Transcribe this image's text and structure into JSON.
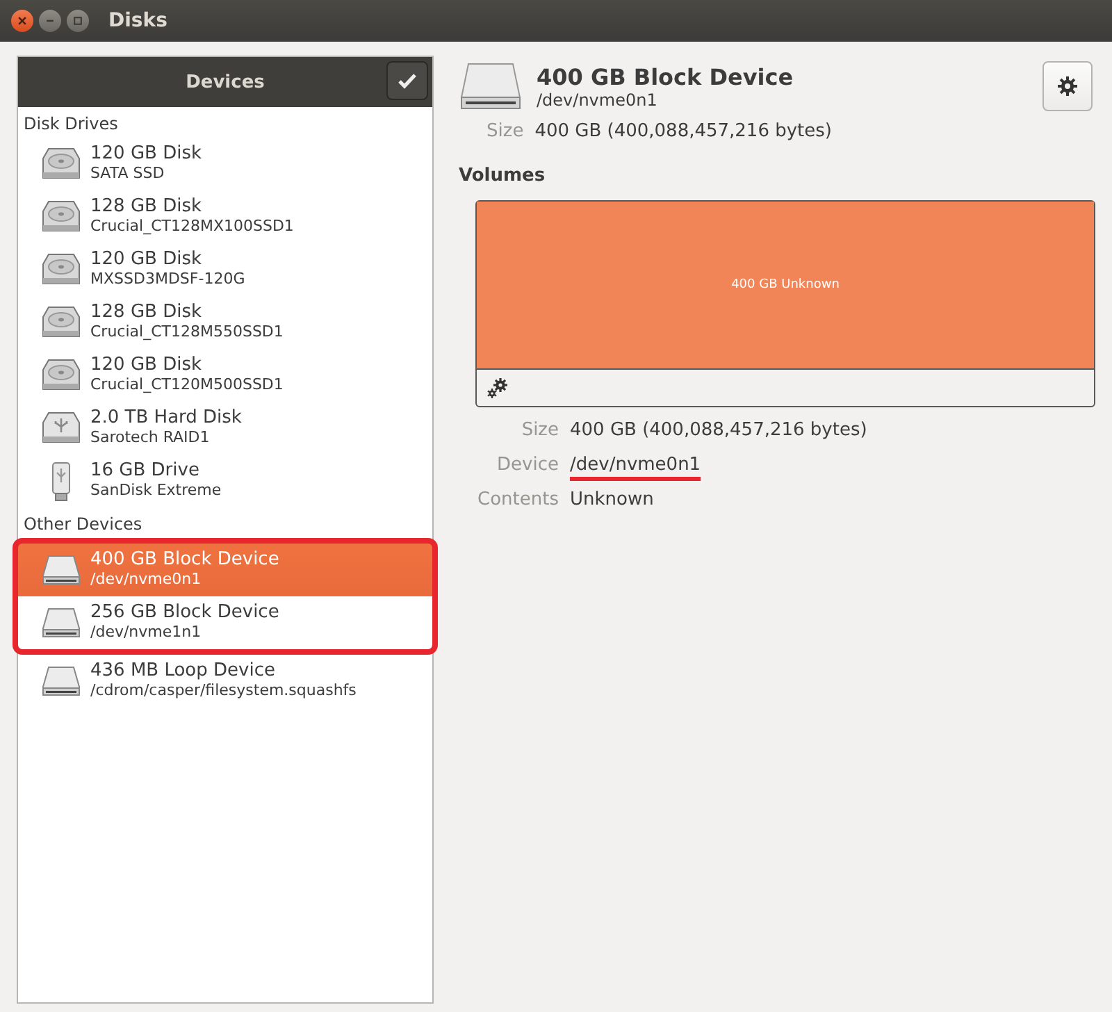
{
  "window": {
    "title": "Disks"
  },
  "sidebar": {
    "title": "Devices",
    "groups": [
      {
        "label": "Disk Drives",
        "items": [
          {
            "kind": "hdd",
            "name": "120 GB Disk",
            "detail": "SATA SSD",
            "selected": false,
            "annotated": false
          },
          {
            "kind": "hdd",
            "name": "128 GB Disk",
            "detail": "Crucial_CT128MX100SSD1",
            "selected": false,
            "annotated": false
          },
          {
            "kind": "hdd",
            "name": "120 GB Disk",
            "detail": "MXSSD3MDSF-120G",
            "selected": false,
            "annotated": false
          },
          {
            "kind": "hdd",
            "name": "128 GB Disk",
            "detail": "Crucial_CT128M550SSD1",
            "selected": false,
            "annotated": false
          },
          {
            "kind": "hdd",
            "name": "120 GB Disk",
            "detail": "Crucial_CT120M500SSD1",
            "selected": false,
            "annotated": false
          },
          {
            "kind": "usb-disk",
            "name": "2.0 TB Hard Disk",
            "detail": "Sarotech RAID1",
            "selected": false,
            "annotated": false
          },
          {
            "kind": "usb-stick",
            "name": "16 GB Drive",
            "detail": "SanDisk Extreme",
            "selected": false,
            "annotated": false
          }
        ]
      },
      {
        "label": "Other Devices",
        "items": [
          {
            "kind": "block",
            "name": "400 GB Block Device",
            "detail": "/dev/nvme0n1",
            "selected": true,
            "annotated": true
          },
          {
            "kind": "block",
            "name": "256 GB Block Device",
            "detail": "/dev/nvme1n1",
            "selected": false,
            "annotated": true
          },
          {
            "kind": "block",
            "name": "436 MB Loop Device",
            "detail": "/cdrom/casper/filesystem.squashfs",
            "selected": false,
            "annotated": false
          }
        ]
      }
    ]
  },
  "device": {
    "title": "400 GB Block Device",
    "path": "/dev/nvme0n1",
    "size_label": "Size",
    "size": "400 GB (400,088,457,216 bytes)"
  },
  "volumes": {
    "title": "Volumes",
    "partitions": [
      {
        "label": "400 GB Unknown",
        "selected": false
      }
    ],
    "details": [
      {
        "label": "Size",
        "value": "400 GB (400,088,457,216 bytes)",
        "annotated": false
      },
      {
        "label": "Device",
        "value": "/dev/nvme0n1",
        "annotated": true
      },
      {
        "label": "Contents",
        "value": "Unknown",
        "annotated": false
      }
    ]
  }
}
